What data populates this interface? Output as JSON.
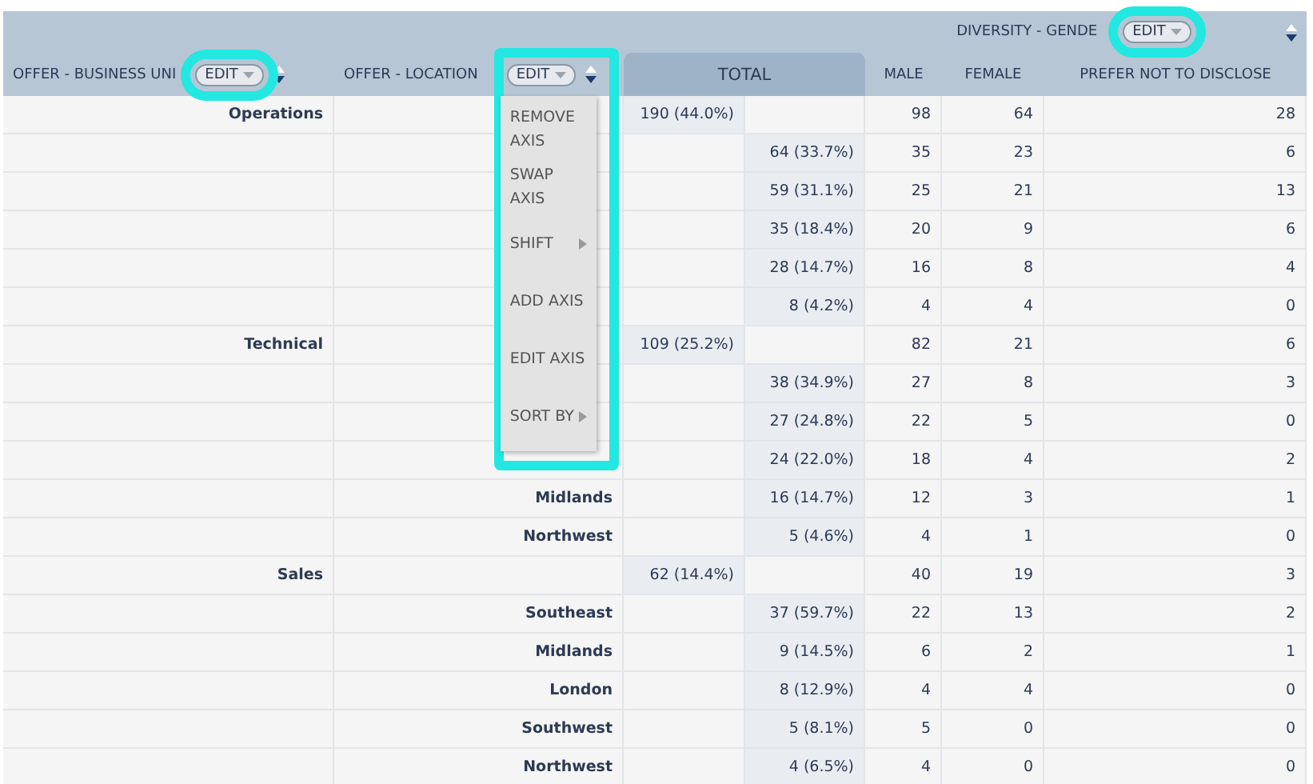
{
  "header": {
    "group_label": "DIVERSITY - GENDE",
    "group_edit": {
      "label": "EDIT",
      "highlighted": true
    },
    "row_axes": [
      {
        "label": "OFFER - BUSINESS UNI",
        "edit": {
          "label": "EDIT",
          "highlighted": true
        }
      },
      {
        "label": "OFFER - LOCATION",
        "edit": {
          "label": "EDIT",
          "highlighted": true
        }
      }
    ],
    "total_label": "TOTAL",
    "columns": [
      "MALE",
      "FEMALE",
      "PREFER NOT TO DISCLOSE"
    ]
  },
  "menu": {
    "open": true,
    "items": [
      {
        "label": "REMOVE AXIS",
        "submenu": false
      },
      {
        "label": "SWAP AXIS",
        "submenu": false
      },
      {
        "label": "SHIFT",
        "submenu": true
      },
      {
        "label": "ADD AXIS",
        "submenu": false
      },
      {
        "label": "EDIT AXIS",
        "submenu": false
      },
      {
        "label": "SORT BY",
        "submenu": true
      }
    ]
  },
  "rows": [
    {
      "kind": "group",
      "unit": "Operations",
      "total": "190 (44.0%)",
      "values": [
        "98",
        "64",
        "28"
      ]
    },
    {
      "kind": "detail",
      "total": "64 (33.7%)",
      "values": [
        "35",
        "23",
        "6"
      ]
    },
    {
      "kind": "detail",
      "total": "59 (31.1%)",
      "values": [
        "25",
        "21",
        "13"
      ]
    },
    {
      "kind": "detail",
      "total": "35 (18.4%)",
      "values": [
        "20",
        "9",
        "6"
      ]
    },
    {
      "kind": "detail",
      "total": "28 (14.7%)",
      "values": [
        "16",
        "8",
        "4"
      ]
    },
    {
      "kind": "detail",
      "total": "8 (4.2%)",
      "values": [
        "4",
        "4",
        "0"
      ]
    },
    {
      "kind": "group",
      "unit": "Technical",
      "total": "109 (25.2%)",
      "values": [
        "82",
        "21",
        "6"
      ]
    },
    {
      "kind": "detail",
      "total": "38 (34.9%)",
      "values": [
        "27",
        "8",
        "3"
      ]
    },
    {
      "kind": "detail",
      "total": "27 (24.8%)",
      "values": [
        "22",
        "5",
        "0"
      ]
    },
    {
      "kind": "detail",
      "total": "24 (22.0%)",
      "values": [
        "18",
        "4",
        "2"
      ]
    },
    {
      "kind": "detail",
      "location": "Midlands",
      "total": "16 (14.7%)",
      "values": [
        "12",
        "3",
        "1"
      ]
    },
    {
      "kind": "detail",
      "location": "Northwest",
      "total": "5 (4.6%)",
      "values": [
        "4",
        "1",
        "0"
      ]
    },
    {
      "kind": "group",
      "unit": "Sales",
      "total": "62 (14.4%)",
      "values": [
        "40",
        "19",
        "3"
      ]
    },
    {
      "kind": "detail",
      "location": "Southeast",
      "total": "37 (59.7%)",
      "values": [
        "22",
        "13",
        "2"
      ]
    },
    {
      "kind": "detail",
      "location": "Midlands",
      "total": "9 (14.5%)",
      "values": [
        "6",
        "2",
        "1"
      ]
    },
    {
      "kind": "detail",
      "location": "London",
      "total": "8 (12.9%)",
      "values": [
        "4",
        "4",
        "0"
      ]
    },
    {
      "kind": "detail",
      "location": "Southwest",
      "total": "5 (8.1%)",
      "values": [
        "5",
        "0",
        "0"
      ]
    },
    {
      "kind": "detail",
      "location": "Northwest",
      "total": "4 (6.5%)",
      "values": [
        "4",
        "0",
        "0"
      ]
    }
  ]
}
